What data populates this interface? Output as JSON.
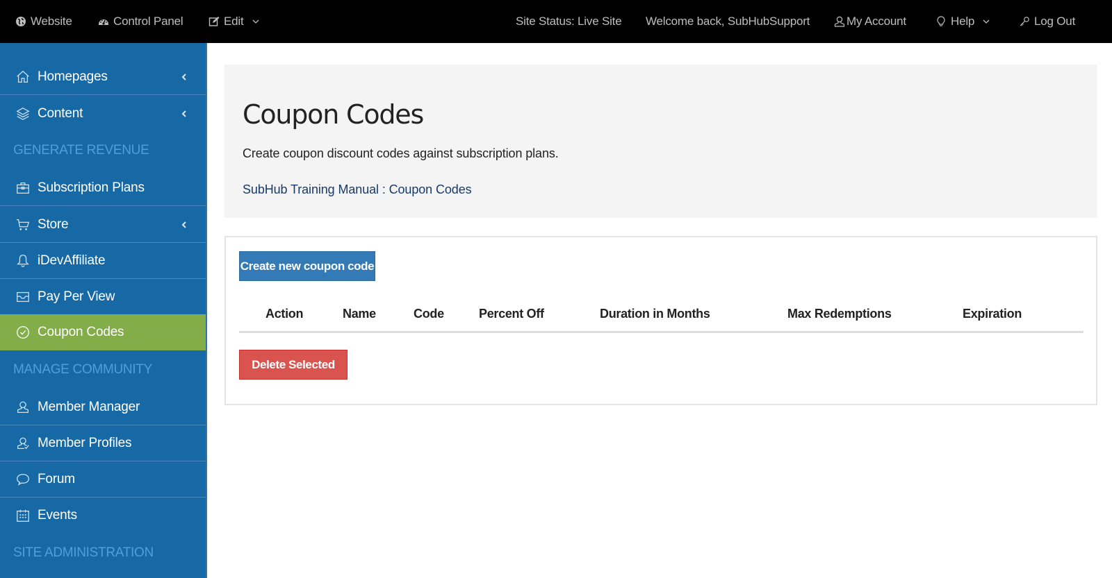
{
  "topbar": {
    "website": {
      "label": "Website",
      "icon": "globe-icon"
    },
    "control_panel": {
      "label": "Control Panel",
      "icon": "dashboard-icon"
    },
    "edit": {
      "label": "Edit",
      "icon": "edit-icon"
    },
    "site_status": "Site Status: Live Site",
    "welcome": "Welcome back, SubHubSupport",
    "my_account": {
      "label": "My Account",
      "icon": "user-icon"
    },
    "help": {
      "label": "Help",
      "icon": "lightbulb-icon"
    },
    "logout": {
      "label": "Log Out",
      "icon": "key-icon"
    }
  },
  "sidebar": {
    "items": [
      {
        "label": "Homepages",
        "icon": "home-icon",
        "has_submenu": true
      },
      {
        "label": "Content",
        "icon": "layers-icon",
        "has_submenu": true
      },
      {
        "label": "Subscription Plans",
        "icon": "briefcase-icon"
      },
      {
        "label": "Store",
        "icon": "cart-icon",
        "has_submenu": true
      },
      {
        "label": "iDevAffiliate",
        "icon": "bell-icon"
      },
      {
        "label": "Pay Per View",
        "icon": "inbox-icon"
      },
      {
        "label": "Coupon Codes",
        "icon": "check-circle-icon",
        "active": true
      },
      {
        "label": "Member Manager",
        "icon": "user-icon"
      },
      {
        "label": "Member Profiles",
        "icon": "user-check-icon"
      },
      {
        "label": "Forum",
        "icon": "speech-bubble-icon"
      },
      {
        "label": "Events",
        "icon": "calendar-icon"
      }
    ],
    "sections": {
      "generate_revenue": "GENERATE REVENUE",
      "manage_community": "MANAGE COMMUNITY",
      "site_administration": "SITE ADMINISTRATION"
    }
  },
  "main": {
    "title": "Coupon Codes",
    "description": "Create coupon discount codes against subscription plans.",
    "manual_link": "SubHub Training Manual : Coupon Codes",
    "create_button": "Create new coupon code",
    "delete_button": "Delete Selected",
    "table": {
      "columns": [
        "Action",
        "Name",
        "Code",
        "Percent Off",
        "Duration in Months",
        "Max Redemptions",
        "Expiration"
      ],
      "rows": []
    }
  },
  "colors": {
    "sidebar_bg": "#1769a5",
    "active_item": "#82ad48",
    "section_heading": "#4f9fdc",
    "primary_button": "#337ab7",
    "danger_button": "#d9534f",
    "link": "#173b6c"
  }
}
